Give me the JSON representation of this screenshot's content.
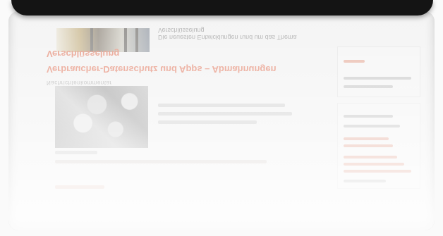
{
  "reflection": {
    "article_caption": "Die neuesten Entwicklungen rund um das Thema Verschlüsselung",
    "headline_line1": "Verschlüsselung",
    "headline_line2": "Verbraucher-Datenschutz und Apps – Abmahnungen",
    "meta": "Nachrichtenkommentar"
  }
}
